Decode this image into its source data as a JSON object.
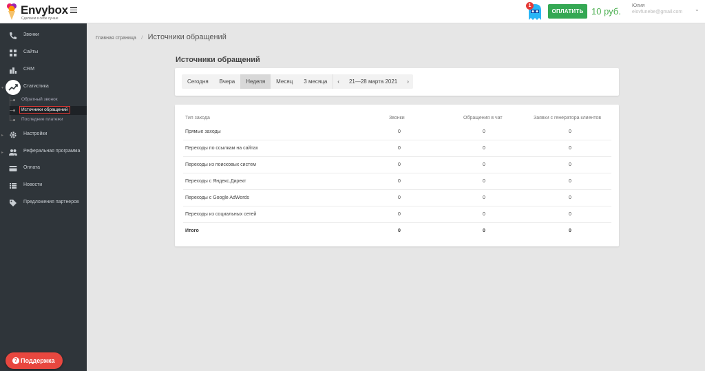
{
  "header": {
    "logo_text": "Envybox",
    "logo_tagline": "Сделаем в себе лучше",
    "notification_count": "1",
    "pay_label": "ОПЛАТИТЬ",
    "balance": "10 руб.",
    "user_name": "Юлия",
    "user_email": "elovfunebe@gmail.com"
  },
  "sidebar": {
    "items": [
      {
        "label": "Звонки",
        "icon": "phone-icon"
      },
      {
        "label": "Сайты",
        "icon": "widgets-icon"
      },
      {
        "label": "CRM",
        "icon": "crm-icon"
      },
      {
        "label": "Статистика",
        "icon": "trending-up-icon"
      },
      {
        "label": "Настройки",
        "icon": "gear-icon"
      },
      {
        "label": "Реферальная программа",
        "icon": "people-icon"
      },
      {
        "label": "Оплата",
        "icon": "card-icon"
      },
      {
        "label": "Новости",
        "icon": "list-icon"
      },
      {
        "label": "Предложения партнеров",
        "icon": "tag-icon"
      }
    ],
    "sub_items": [
      {
        "label": "Обратный звонок"
      },
      {
        "label": "Источники обращений"
      },
      {
        "label": "Последние платежи"
      }
    ],
    "support_label": "Поддержка"
  },
  "breadcrumb": {
    "home": "Главная страница",
    "separator": "/",
    "current": "Источники обращений"
  },
  "page": {
    "title": "Источники обращений"
  },
  "filters": {
    "buttons": [
      "Сегодня",
      "Вчера",
      "Неделя",
      "Месяц",
      "3 месяца"
    ],
    "active": "Неделя",
    "prev": "‹",
    "next": "›",
    "date_range": "21—28 марта 2021"
  },
  "table": {
    "headers": [
      "Тип захода",
      "Звонки",
      "Обращения в чат",
      "Заявки с генератора клиентов"
    ],
    "rows": [
      [
        "Прямые заходы",
        "0",
        "0",
        "0"
      ],
      [
        "Переходы по ссылкам на сайтах",
        "0",
        "0",
        "0"
      ],
      [
        "Переходы из поисковых систем",
        "0",
        "0",
        "0"
      ],
      [
        "Переходы с Яндекс.Директ",
        "0",
        "0",
        "0"
      ],
      [
        "Переходы с Google AdWords",
        "0",
        "0",
        "0"
      ],
      [
        "Переходы из социальных сетей",
        "0",
        "0",
        "0"
      ]
    ],
    "total": [
      "Итого",
      "0",
      "0",
      "0"
    ]
  },
  "colors": {
    "sidebar_bg": "#2f353a",
    "pay_green": "#34a853",
    "support_red": "#e8473f",
    "active_highlight": "#e53935"
  }
}
